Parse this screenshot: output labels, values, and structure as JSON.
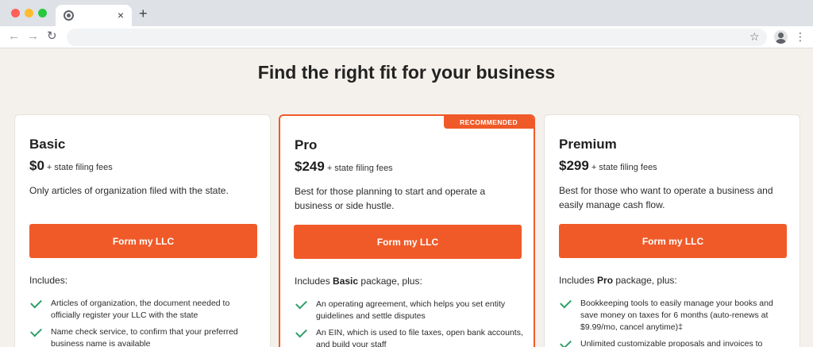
{
  "browser": {
    "tab_close": "×",
    "new_tab": "+",
    "back": "←",
    "forward": "→",
    "reload": "↻",
    "star": "☆",
    "menu": "⋮"
  },
  "page": {
    "title": "Find the right fit for your business"
  },
  "colors": {
    "accent": "#f05a28",
    "check": "#2e9e6a",
    "background": "#f4f1ec"
  },
  "plans": [
    {
      "name": "Basic",
      "price": "$0",
      "fees": "+ state filing fees",
      "description": "Only articles of organization filed with the state.",
      "cta": "Form my LLC",
      "includes_prefix": "Includes:",
      "includes_bold": "",
      "includes_suffix": "",
      "features": [
        "Articles of organization, the document needed to officially register your LLC with the state",
        "Name check service, to confirm that your preferred business name is available"
      ]
    },
    {
      "name": "Pro",
      "badge": "RECOMMENDED",
      "price": "$249",
      "fees": "+ state filing fees",
      "description": "Best for those planning to start and operate a business or side hustle.",
      "cta": "Form my LLC",
      "includes_prefix": "Includes ",
      "includes_bold": "Basic",
      "includes_suffix": " package, plus:",
      "features": [
        "An operating agreement, which helps you set entity guidelines and settle disputes",
        "An EIN, which is used to file taxes, open bank accounts, and build your staff"
      ]
    },
    {
      "name": "Premium",
      "price": "$299",
      "fees": "+ state filing fees",
      "description": "Best for those who want to operate a business and easily manage cash flow.",
      "cta": "Form my LLC",
      "includes_prefix": "Includes ",
      "includes_bold": "Pro",
      "includes_suffix": " package, plus:",
      "features": [
        "Bookkeeping tools to easily manage your books and save money on taxes for 6 months (auto-renews at $9.99/mo, cancel anytime)‡",
        "Unlimited customizable proposals and invoices to"
      ]
    }
  ]
}
